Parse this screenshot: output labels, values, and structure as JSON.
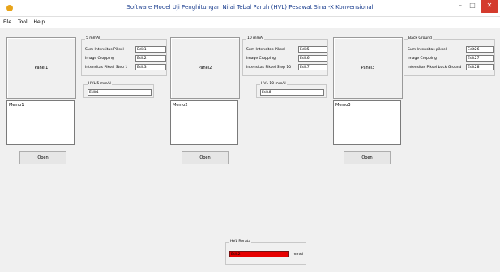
{
  "window": {
    "title": "Software Model Uji Penghitungan Nilai Tebal Paruh  (HVL) Pesawat Sinar-X  Konvensional",
    "minimize": "–",
    "maximize": "□",
    "close": "✕"
  },
  "menu": [
    "File",
    "Tool",
    "Help"
  ],
  "columns": [
    {
      "panel": "Panel1",
      "memo": "Memo1",
      "open": "Open",
      "group1": {
        "title": "5 mmAl",
        "rows": [
          {
            "label": "Sum Intensitas Piksel",
            "value": "Edit1"
          },
          {
            "label": "Image Cropping",
            "value": "Edit2"
          },
          {
            "label": "Intensitas Piksel Step 1",
            "value": "Edit3"
          }
        ]
      },
      "group2": {
        "title": "HVL 5 mmAl",
        "value": "Edit4"
      }
    },
    {
      "panel": "Panel2",
      "memo": "Memo2",
      "open": "Open",
      "group1": {
        "title": "10 mmAl",
        "rows": [
          {
            "label": "Sum Intensitas Piksel",
            "value": "Edit5"
          },
          {
            "label": "Image Cropping",
            "value": "Edit6"
          },
          {
            "label": "Intensitas Piksel Step 10",
            "value": "Edit7"
          }
        ]
      },
      "group2": {
        "title": "HVL 10 mmAl",
        "value": "Edit8"
      }
    },
    {
      "panel": "Panel3",
      "memo": "Memo3",
      "open": "Open",
      "group1": {
        "title": "Back Ground",
        "rows": [
          {
            "label": "Sum Intensitas piksel",
            "value": "Edit26"
          },
          {
            "label": "Image Cropping",
            "value": "Edit27"
          },
          {
            "label": "Intensitas Piksel back Ground",
            "value": "Edit28"
          }
        ]
      }
    }
  ],
  "hvl_rerata": {
    "title": "HVL Rerata",
    "value": "Edit2",
    "unit": "mmAl",
    "color": "#e60000"
  }
}
